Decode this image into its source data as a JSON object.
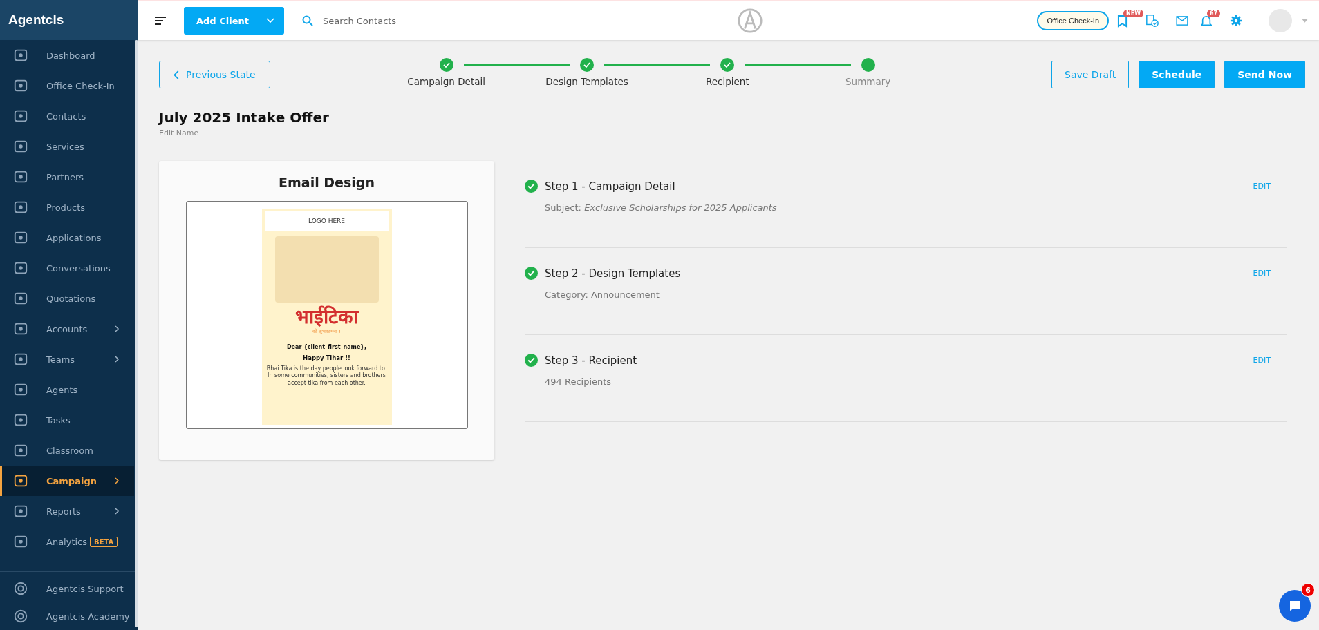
{
  "brand": "Agentcis",
  "sidebar": {
    "items": [
      {
        "label": "Dashboard",
        "selected": false,
        "chevron": false
      },
      {
        "label": "Office Check-In",
        "selected": false,
        "chevron": false
      },
      {
        "label": "Contacts",
        "selected": false,
        "chevron": false
      },
      {
        "label": "Services",
        "selected": false,
        "chevron": false
      },
      {
        "label": "Partners",
        "selected": false,
        "chevron": false
      },
      {
        "label": "Products",
        "selected": false,
        "chevron": false
      },
      {
        "label": "Applications",
        "selected": false,
        "chevron": false
      },
      {
        "label": "Conversations",
        "selected": false,
        "chevron": false
      },
      {
        "label": "Quotations",
        "selected": false,
        "chevron": false
      },
      {
        "label": "Accounts",
        "selected": false,
        "chevron": true
      },
      {
        "label": "Teams",
        "selected": false,
        "chevron": true
      },
      {
        "label": "Agents",
        "selected": false,
        "chevron": false
      },
      {
        "label": "Tasks",
        "selected": false,
        "chevron": false
      },
      {
        "label": "Classroom",
        "selected": false,
        "chevron": false
      },
      {
        "label": "Campaign",
        "selected": true,
        "chevron": true
      },
      {
        "label": "Reports",
        "selected": false,
        "chevron": true
      },
      {
        "label": "Analytics",
        "selected": false,
        "chevron": false,
        "badge": "BETA"
      }
    ],
    "footer_items": [
      {
        "label": "Agentcis Support"
      },
      {
        "label": "Agentcis Academy"
      }
    ]
  },
  "topbar": {
    "add_button": "Add Client",
    "search": {
      "placeholder": "Search Contacts"
    },
    "checkin_button": "Office Check-In",
    "new_badge": "NEW",
    "notification_count": "67"
  },
  "wizard": {
    "back_button": "Previous State",
    "steps": [
      {
        "label": "Campaign Detail",
        "done": true
      },
      {
        "label": "Design Templates",
        "done": true
      },
      {
        "label": "Recipient",
        "done": true
      },
      {
        "label": "Summary",
        "done": false
      }
    ],
    "actions": [
      {
        "label": "Save Draft",
        "kind": "outline"
      },
      {
        "label": "Schedule",
        "kind": "solid"
      },
      {
        "label": "Send Now",
        "kind": "solid"
      }
    ]
  },
  "campaign": {
    "title": "July 2025 Intake Offer",
    "edit_name": "Edit Name"
  },
  "email_design": {
    "title": "Email Design",
    "logo": "LOGO HERE",
    "headline": "भाईटिका",
    "tagline": "को शुभकामना !",
    "greeting": "Dear {client_first_name},",
    "wish": "Happy Tihar !!",
    "body": "Bhai Tika is the day people look forward to. In some communities, sisters and brothers accept tika from each other."
  },
  "summary": [
    {
      "title": "Step 1 - Campaign Detail",
      "detail": "Subject: *Exclusive Scholarships for 2025 Applicants*",
      "edit": "EDIT",
      "done": true
    },
    {
      "title": "Step 2 - Design Templates",
      "detail": "Category: Announcement",
      "edit": "EDIT",
      "done": true
    },
    {
      "title": "Step 3 - Recipient",
      "detail": "494 Recipients",
      "edit": "EDIT",
      "done": true
    }
  ],
  "chat": {
    "unread": "6"
  }
}
